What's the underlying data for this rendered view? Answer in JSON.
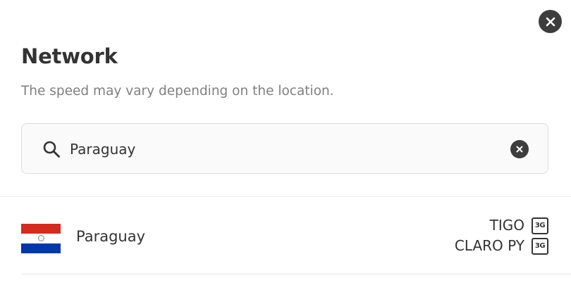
{
  "dialog": {
    "title": "Network",
    "subtitle": "The speed may vary depending on the location."
  },
  "search": {
    "value": "Paraguay",
    "placeholder": ""
  },
  "results": [
    {
      "country": "Paraguay",
      "flag": "paraguay-flag",
      "carriers": [
        {
          "name": "TIGO",
          "network": "3G"
        },
        {
          "name": "CLARO PY",
          "network": "3G"
        }
      ]
    }
  ],
  "colors": {
    "icon_dark": "#3d3d3d",
    "text": "#333333",
    "subtext": "#808080",
    "flag_red": "#d52b1e",
    "flag_blue": "#0038a8"
  }
}
